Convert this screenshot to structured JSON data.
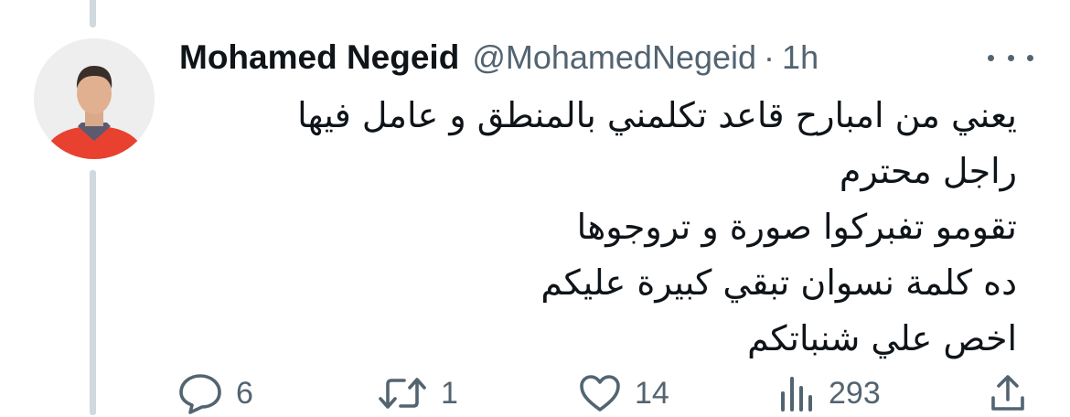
{
  "tweet": {
    "display_name": "Mohamed Negeid",
    "handle": "@MohamedNegeid",
    "separator": "·",
    "time": "1h",
    "text_lines": [
      "يعني من امبارح قاعد تكلمني بالمنطق و عامل فيها",
      "راجل محترم",
      "تقومو تفبركوا صورة و تروجوها",
      "ده كلمة نسوان تبقي كبيرة عليكم",
      "اخص علي شنباتكم"
    ]
  },
  "actions": {
    "replies": "6",
    "retweets": "1",
    "likes": "14",
    "views": "293"
  },
  "icons": {
    "reply": "reply-icon",
    "retweet": "retweet-icon",
    "like": "heart-icon",
    "views": "views-chart-icon",
    "share": "share-icon",
    "more": "more-dots-icon"
  },
  "colors": {
    "text": "#0f1419",
    "secondary": "#536471",
    "thread_line": "#cfd9de"
  }
}
